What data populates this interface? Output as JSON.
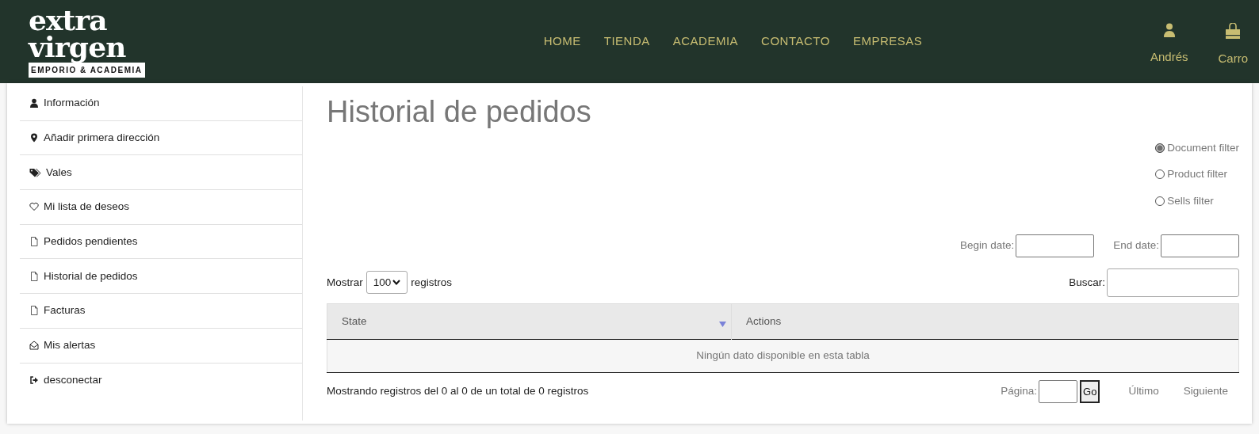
{
  "logo": {
    "line_1": "extra",
    "line_2": "virgen",
    "tagline": "EMPORIO & ACADEMIA"
  },
  "nav": [
    {
      "label": "HOME"
    },
    {
      "label": "TIENDA"
    },
    {
      "label": "ACADEMIA"
    },
    {
      "label": "CONTACTO"
    },
    {
      "label": "EMPRESAS"
    }
  ],
  "user_menu": [
    {
      "kind": "user",
      "label": "Andrés"
    },
    {
      "kind": "cart",
      "label": "Carro"
    }
  ],
  "sidebar": {
    "items": [
      {
        "kind": "user",
        "label": "Información"
      },
      {
        "kind": "pin",
        "label": "Añadir primera dirección"
      },
      {
        "kind": "tags",
        "label": "Vales"
      },
      {
        "kind": "heart",
        "label": "Mi lista de deseos"
      },
      {
        "kind": "file",
        "label": "Pedidos pendientes"
      },
      {
        "kind": "file",
        "label": "Historial de pedidos"
      },
      {
        "kind": "file",
        "label": "Facturas"
      },
      {
        "kind": "envelope",
        "label": "Mis alertas"
      },
      {
        "kind": "logout",
        "label": "desconectar"
      }
    ]
  },
  "title": "Historial de pedidos",
  "filters": [
    {
      "label": "Document filter",
      "selected": true
    },
    {
      "label": "Product filter",
      "selected": false
    },
    {
      "label": "Sells filter",
      "selected": false
    }
  ],
  "begin_date": {
    "label": "Begin date:"
  },
  "end_date": {
    "label": "End date:"
  },
  "length": {
    "prefix": "Mostrar",
    "value": "100",
    "suffix": "registros"
  },
  "search": {
    "label": "Buscar:"
  },
  "table": {
    "columns": [
      {
        "label": "State",
        "sorted": true
      },
      {
        "label": "Actions",
        "sorted": false
      }
    ],
    "empty": "Ningún dato disponible en esta tabla"
  },
  "info": "Mostrando registros del 0 al 0 de un total de 0 registros",
  "pagination": {
    "page_label": "Página:",
    "go": "Go",
    "last": "Último",
    "next": "Siguiente"
  }
}
